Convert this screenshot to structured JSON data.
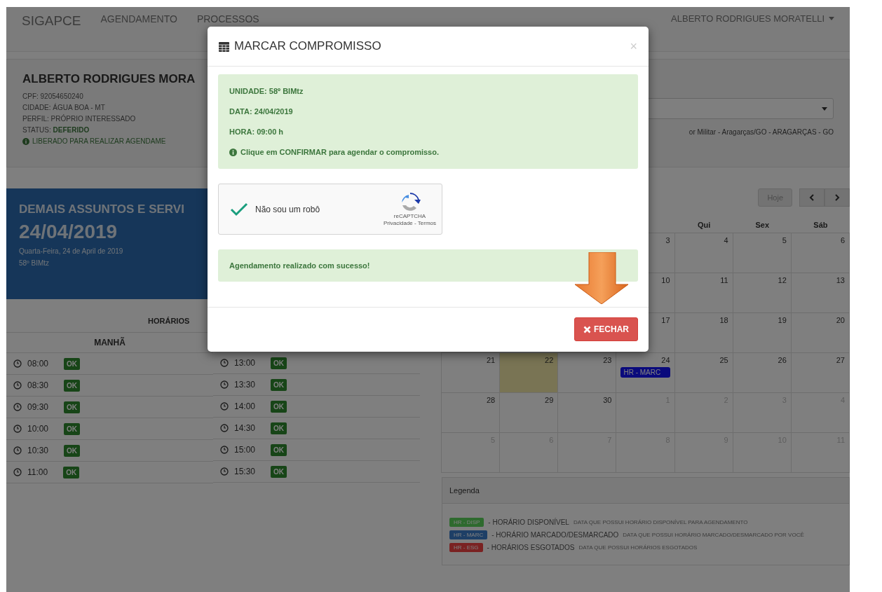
{
  "navbar": {
    "brand": "SIGAPCE",
    "links": [
      {
        "label": "AGENDAMENTO"
      },
      {
        "label": "PROCESSOS"
      }
    ],
    "user_menu": "ALBERTO RODRIGUES MORATELLI"
  },
  "profile": {
    "name": "ALBERTO RODRIGUES MORA",
    "lines": [
      {
        "label": "CPF:",
        "value": "92054650240"
      },
      {
        "label": "CIDADE:",
        "value": "ÁGUA BOA - MT"
      },
      {
        "label": "PERFIL:",
        "value": "PRÓPRIO INTERESSADO"
      }
    ],
    "status": {
      "label": "STATUS:",
      "value": "DEFERIDO"
    },
    "notice": "LIBERADO PARA REALIZAR AGENDAME"
  },
  "unit_panel": {
    "location": "or Militar - Aragarças/GO - ARAGARÇAS - GO"
  },
  "service_panel": {
    "title": "DEMAIS ASSUNTOS E SERVI",
    "date": "24/04/2019",
    "weekday": "Quarta-Feira, 24 de April de 2019",
    "unit": "58º BIMtz"
  },
  "schedule": {
    "title": "HORÁRIOS",
    "columns": [
      {
        "heading": "MANHÃ",
        "slots": [
          {
            "time": "08:00",
            "badge": "OK"
          },
          {
            "time": "08:30",
            "badge": "OK"
          },
          {
            "time": "09:30",
            "badge": "OK"
          },
          {
            "time": "10:00",
            "badge": "OK"
          },
          {
            "time": "10:30",
            "badge": "OK"
          },
          {
            "time": "11:00",
            "badge": "OK"
          }
        ]
      },
      {
        "slots": [
          {
            "time": "13:00",
            "badge": "OK"
          },
          {
            "time": "13:30",
            "badge": "OK"
          },
          {
            "time": "14:00",
            "badge": "OK"
          },
          {
            "time": "14:30",
            "badge": "OK"
          },
          {
            "time": "15:00",
            "badge": "OK"
          },
          {
            "time": "15:30",
            "badge": "OK"
          }
        ]
      }
    ]
  },
  "calendar": {
    "today_button": "Hoje",
    "headers": [
      "Qui",
      "Sex",
      "Sáb"
    ],
    "weeks": [
      {
        "days": [
          {
            "day": "3",
            "other_month": false,
            "today": false
          },
          {
            "day": "4",
            "other_month": false,
            "today": false
          },
          {
            "day": "5",
            "other_month": false,
            "today": false
          },
          {
            "day": "6",
            "other_month": false,
            "today": false
          }
        ]
      },
      {
        "days": [
          {
            "day": "10",
            "other_month": false,
            "today": false
          },
          {
            "day": "11",
            "other_month": false,
            "today": false
          },
          {
            "day": "12",
            "other_month": false,
            "today": false
          },
          {
            "day": "13",
            "other_month": false,
            "today": false
          }
        ]
      },
      {
        "days": [
          {
            "day": "17",
            "other_month": false,
            "today": false
          },
          {
            "day": "18",
            "other_month": false,
            "today": false
          },
          {
            "day": "19",
            "other_month": false,
            "today": false
          },
          {
            "day": "20",
            "other_month": false,
            "today": false
          }
        ]
      },
      {
        "days": [
          {
            "day": "21",
            "other_month": false,
            "today": false
          },
          {
            "day": "22",
            "other_month": false,
            "today": true
          },
          {
            "day": "23",
            "other_month": false,
            "today": false
          },
          {
            "day": "24",
            "other_month": false,
            "today": false,
            "event": {
              "label": "HR - MARC",
              "color": "#0a0a7c"
            }
          },
          {
            "day": "25",
            "other_month": false,
            "today": false
          },
          {
            "day": "26",
            "other_month": false,
            "today": false
          },
          {
            "day": "27",
            "other_month": false,
            "today": false
          }
        ]
      },
      {
        "days": [
          {
            "day": "28",
            "other_month": false,
            "today": false
          },
          {
            "day": "29",
            "other_month": false,
            "today": false
          },
          {
            "day": "30",
            "other_month": false,
            "today": false
          },
          {
            "day": "1",
            "other_month": true,
            "today": false
          },
          {
            "day": "2",
            "other_month": true,
            "today": false
          },
          {
            "day": "3",
            "other_month": true,
            "today": false
          },
          {
            "day": "4",
            "other_month": true,
            "today": false
          }
        ]
      },
      {
        "days": [
          {
            "day": "5",
            "other_month": true,
            "today": false
          },
          {
            "day": "6",
            "other_month": true,
            "today": false
          },
          {
            "day": "7",
            "other_month": true,
            "today": false
          },
          {
            "day": "8",
            "other_month": true,
            "today": false
          },
          {
            "day": "9",
            "other_month": true,
            "today": false
          },
          {
            "day": "10",
            "other_month": true,
            "today": false
          },
          {
            "day": "11",
            "other_month": true,
            "today": false
          }
        ]
      }
    ]
  },
  "legend": {
    "title": "Legenda",
    "items": [
      {
        "badge": "HR - DISP",
        "color": "#2e6a2e",
        "label": "- HORÁRIO DISPONÍVEL",
        "note": "DATA QUE POSSUI HORÁRIO DISPONÍVEL PARA AGENDAMENTO"
      },
      {
        "badge": "HR - MARC",
        "color": "#1e3f66",
        "label": "- HORÁRIO MARCADO/DESMARCADO",
        "note": "DATA QUE POSSUI HORÁRIO MARCADO/DESMARCADO POR VOCÊ"
      },
      {
        "badge": "HR - ESG",
        "color": "#7a2222",
        "label": "- HORÁRIOS ESGOTADOS",
        "note": "DATA QUE POSSUI HORÁRIOS ESGOTADOS"
      }
    ]
  },
  "modal": {
    "title": "MARCAR COMPROMISSO",
    "close": "×",
    "details": [
      {
        "label": "UNIDADE:",
        "value": "58º BIMtz"
      },
      {
        "label": "DATA:",
        "value": "24/04/2019"
      },
      {
        "label": "HORA:",
        "value": "09:00 h"
      }
    ],
    "hint": "Clique em CONFIRMAR para agendar o compromisso.",
    "captcha": {
      "label": "Não sou um robô",
      "checked": true,
      "brand": "reCAPTCHA",
      "links": "Privacidade - Termos"
    },
    "success": "Agendamento realizado com sucesso!",
    "button": "FECHAR"
  }
}
